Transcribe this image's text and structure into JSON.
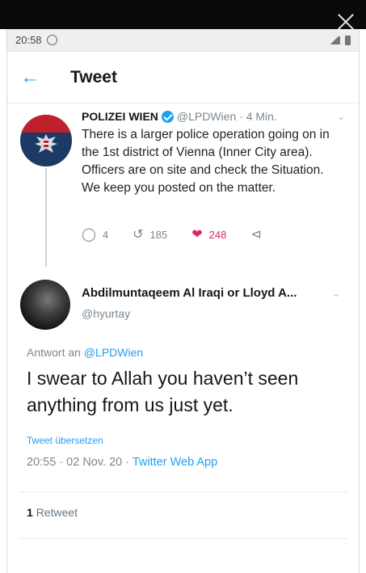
{
  "status_bar": {
    "time": "20:58",
    "whatsapp_icon": "whatsapp-icon",
    "signal_icon": "signal-icon",
    "battery_icon": "battery-icon"
  },
  "app_bar": {
    "back_icon": "arrow-left-icon",
    "title": "Tweet"
  },
  "tweet_original": {
    "author_name": "POLIZEI WIEN",
    "verified": true,
    "handle": "@LPDWien",
    "separator": "·",
    "time": "4 Min.",
    "text": "There is a larger police operation going on in the 1st district of Vienna (Inner City area). Officers are on site and check the Situation. We keep you posted on the matter.",
    "replies": "4",
    "retweets": "185",
    "likes": "248"
  },
  "tweet_reply": {
    "author_name": "Abdilmuntaqeem Al Iraqi or Lloyd A...",
    "handle": "@hyurtay",
    "reply_prefix": "Antwort an",
    "reply_mention": "@LPDWien",
    "text": "I swear to Allah you haven’t seen anything from us just yet.",
    "translate_label": "Tweet übersetzen",
    "timestamp": "20:55 · 02 Nov. 20 ·",
    "source": "Twitter Web App",
    "retweet_count": "1",
    "retweet_label": "Retweet"
  },
  "colors": {
    "accent": "#1da1f2",
    "like": "#e0245e",
    "muted": "#7a8790"
  }
}
